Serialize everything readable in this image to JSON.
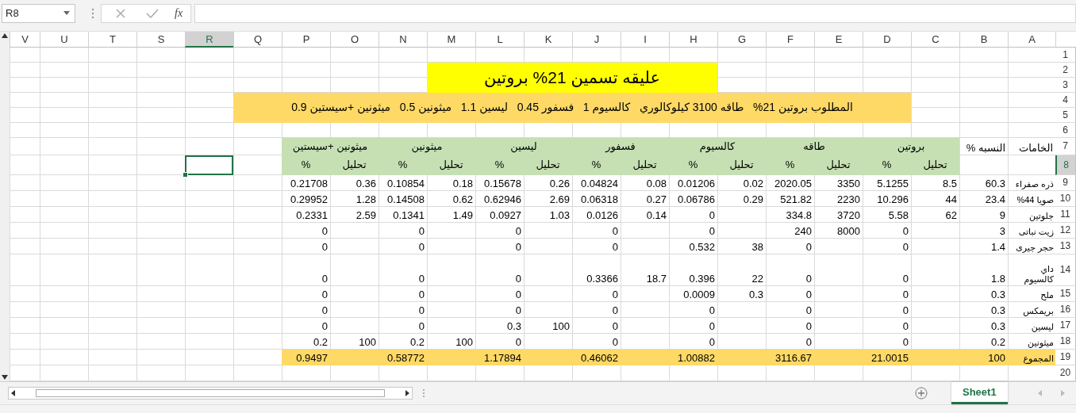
{
  "formula_bar": {
    "name_box": "R8",
    "fx_label": "fx"
  },
  "columns": [
    {
      "label": "A",
      "selected": false
    },
    {
      "label": "B",
      "selected": false
    },
    {
      "label": "C",
      "selected": false
    },
    {
      "label": "D",
      "selected": false
    },
    {
      "label": "E",
      "selected": false
    },
    {
      "label": "F",
      "selected": false
    },
    {
      "label": "G",
      "selected": false
    },
    {
      "label": "H",
      "selected": false
    },
    {
      "label": "I",
      "selected": false
    },
    {
      "label": "J",
      "selected": false
    },
    {
      "label": "K",
      "selected": false
    },
    {
      "label": "L",
      "selected": false
    },
    {
      "label": "M",
      "selected": false
    },
    {
      "label": "N",
      "selected": false
    },
    {
      "label": "O",
      "selected": false
    },
    {
      "label": "P",
      "selected": false
    },
    {
      "label": "Q",
      "selected": false
    },
    {
      "label": "R",
      "selected": true
    },
    {
      "label": "S",
      "selected": false
    },
    {
      "label": "T",
      "selected": false
    },
    {
      "label": "U",
      "selected": false
    },
    {
      "label": "V",
      "selected": false
    }
  ],
  "row_headers": [
    {
      "label": "1",
      "selected": false
    },
    {
      "label": "2",
      "selected": false
    },
    {
      "label": "3",
      "selected": false
    },
    {
      "label": "4",
      "selected": false
    },
    {
      "label": "5",
      "selected": false
    },
    {
      "label": "6",
      "selected": false
    },
    {
      "label": "7",
      "selected": false
    },
    {
      "label": "8",
      "selected": true
    },
    {
      "label": "9",
      "selected": false
    },
    {
      "label": "10",
      "selected": false
    },
    {
      "label": "11",
      "selected": false
    },
    {
      "label": "12",
      "selected": false
    },
    {
      "label": "13",
      "selected": false
    },
    {
      "label": "14",
      "selected": false
    },
    {
      "label": "15",
      "selected": false
    },
    {
      "label": "16",
      "selected": false
    },
    {
      "label": "17",
      "selected": false
    },
    {
      "label": "18",
      "selected": false
    },
    {
      "label": "19",
      "selected": false
    },
    {
      "label": "20",
      "selected": false
    }
  ],
  "title": "عليقه تسمين 21% بروتين",
  "requirements": "المطلوب بروتين 21%   طاقه 3100 كيلوكالوري   كالسيوم 1   فسفور 0.45   ليسين 1.1   ميثونين 0.5   ميثونين +سيستين 0.9",
  "header": {
    "material": "الخامات",
    "ratio": "النسبه %",
    "groups": [
      {
        "name": "بروتين",
        "sub": [
          "تحليل",
          "%"
        ]
      },
      {
        "name": "طاقه",
        "sub": [
          "تحليل",
          "%"
        ]
      },
      {
        "name": "كالسيوم",
        "sub": [
          "تحليل",
          "%"
        ]
      },
      {
        "name": "فسفور",
        "sub": [
          "تحليل",
          "%"
        ]
      },
      {
        "name": "ليسين",
        "sub": [
          "تحليل",
          "%"
        ]
      },
      {
        "name": "ميثونين",
        "sub": [
          "تحليل",
          "%"
        ]
      },
      {
        "name": "ميثونين +سيستين",
        "sub": [
          "تحليل",
          "%"
        ]
      }
    ]
  },
  "data_rows": [
    {
      "cells": [
        "ذره صفراء",
        "60.3",
        "8.5",
        "5.1255",
        "3350",
        "2020.05",
        "0.02",
        "0.01206",
        "0.08",
        "0.04824",
        "0.26",
        "0.15678",
        "0.18",
        "0.10854",
        "0.36",
        "0.21708"
      ]
    },
    {
      "cells": [
        "صويا 44%",
        "23.4",
        "44",
        "10.296",
        "2230",
        "521.82",
        "0.29",
        "0.06786",
        "0.27",
        "0.06318",
        "2.69",
        "0.62946",
        "0.62",
        "0.14508",
        "1.28",
        "0.29952"
      ]
    },
    {
      "cells": [
        "جلوتين",
        "9",
        "62",
        "5.58",
        "3720",
        "334.8",
        null,
        "0",
        "0.14",
        "0.0126",
        "1.03",
        "0.0927",
        "1.49",
        "0.1341",
        "2.59",
        "0.2331"
      ]
    },
    {
      "cells": [
        "زيت نباتى",
        "3",
        null,
        "0",
        "8000",
        "240",
        null,
        "0",
        null,
        "0",
        null,
        "0",
        null,
        "0",
        null,
        "0"
      ]
    },
    {
      "cells": [
        "حجر جيرى",
        "1.4",
        null,
        "0",
        null,
        "0",
        "38",
        "0.532",
        null,
        "0",
        null,
        "0",
        null,
        "0",
        null,
        "0"
      ]
    },
    {
      "cells": [
        "داي كالسيوم",
        "1.8",
        null,
        "0",
        null,
        "0",
        "22",
        "0.396",
        "18.7",
        "0.3366",
        null,
        "0",
        null,
        "0",
        null,
        "0"
      ]
    },
    {
      "cells": [
        "ملح",
        "0.3",
        null,
        "0",
        null,
        "0",
        "0.3",
        "0.0009",
        null,
        "0",
        null,
        "0",
        null,
        "0",
        null,
        "0"
      ]
    },
    {
      "cells": [
        "بريمكس",
        "0.3",
        null,
        "0",
        null,
        "0",
        null,
        "0",
        null,
        "0",
        null,
        "0",
        null,
        "0",
        null,
        "0"
      ]
    },
    {
      "cells": [
        "ليسين",
        "0.3",
        null,
        "0",
        null,
        "0",
        null,
        "0",
        null,
        "0",
        "100",
        "0.3",
        null,
        "0",
        null,
        "0"
      ]
    },
    {
      "cells": [
        "ميثونين",
        "0.2",
        null,
        "0",
        null,
        "0",
        null,
        "0",
        null,
        "0",
        null,
        "0",
        "100",
        "0.2",
        "100",
        "0.2"
      ]
    }
  ],
  "total_row": {
    "cells": [
      "المجموع",
      "100",
      null,
      "21.0015",
      null,
      "3116.67",
      null,
      "1.00882",
      null,
      "0.46062",
      null,
      "1.17894",
      null,
      "0.58772",
      null,
      "0.9497"
    ]
  },
  "sheet_tabs": [
    {
      "label": "Sheet1",
      "selected": true
    }
  ]
}
